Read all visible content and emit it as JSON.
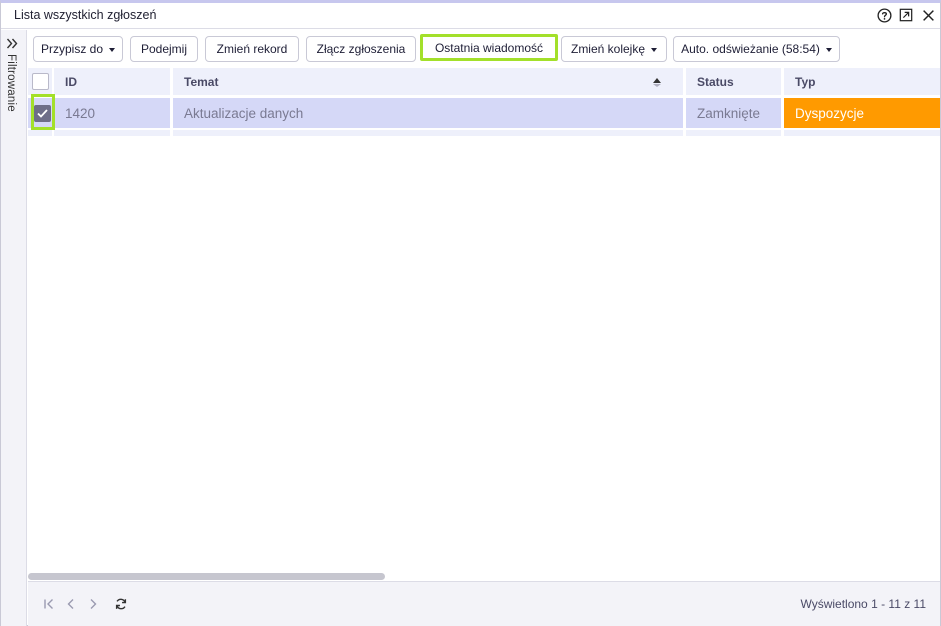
{
  "window": {
    "title": "Lista wszystkich zgłoszeń"
  },
  "sidebar": {
    "label": "Filtrowanie"
  },
  "toolbar": {
    "assign_label": "Przypisz do",
    "take_label": "Podejmij",
    "change_record_label": "Zmień rekord",
    "merge_label": "Złącz zgłoszenia",
    "last_message_label": "Ostatnia wiadomość",
    "change_queue_label": "Zmień kolejkę",
    "auto_refresh_label": "Auto. odświeżanie (58:54)"
  },
  "grid": {
    "columns": [
      "ID",
      "Temat",
      "Status",
      "Typ"
    ],
    "rows": [
      {
        "id": "1420",
        "subject": "Aktualizacje danych",
        "status": "Zamknięte",
        "type": "Dyspozycje",
        "checked": true
      }
    ]
  },
  "footer": {
    "info": "Wyświetlono 1 - 11 z 11"
  },
  "colors": {
    "highlight": "#a3e02a",
    "type_badge": "#ff9a00",
    "selected_row": "#d5d8f7",
    "header_bg": "#eef0fb"
  },
  "icons": [
    "help-icon",
    "popout-icon",
    "close-icon",
    "double-chevron-right-icon",
    "sort-icon",
    "first-page-icon",
    "prev-page-icon",
    "next-page-icon",
    "refresh-icon"
  ]
}
